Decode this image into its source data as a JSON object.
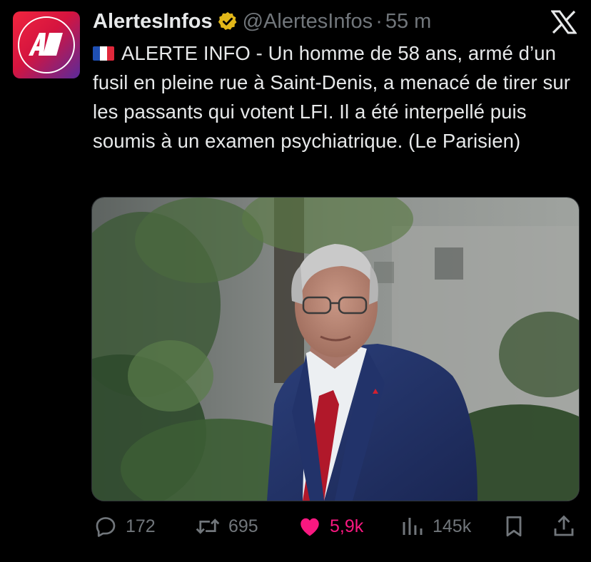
{
  "author": {
    "name": "AlertesInfos",
    "handle": "@AlertesInfos",
    "separator": "·",
    "time": "55 m",
    "avatar_text": "AI"
  },
  "icons": {
    "verified": "verified-badge-icon",
    "platform": "x-logo-icon",
    "flag": "france-flag-icon"
  },
  "tweet": {
    "text": "ALERTE INFO - Un homme de 58 ans, armé d’un fusil en pleine rue à Saint-Denis, a menacé de tirer sur les passants qui votent LFI. Il a été interpellé puis soumis à un examen psychiatrique. (Le Parisien)"
  },
  "actions": {
    "replies": "172",
    "reposts": "695",
    "likes": "5,9k",
    "views": "145k"
  },
  "colors": {
    "background": "#000000",
    "text": "#e7e9ea",
    "muted": "#71767b",
    "like": "#f91880",
    "verified": "#e2b719",
    "avatar_red": "#e8203f",
    "avatar_purple": "#5a2a9a"
  }
}
